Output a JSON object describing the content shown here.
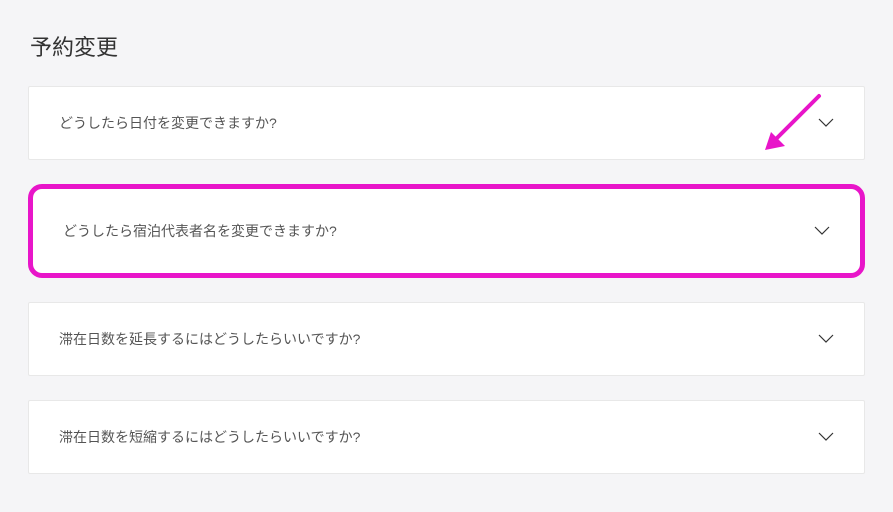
{
  "section": {
    "title": "予約変更"
  },
  "faq": {
    "items": [
      {
        "label": "どうしたら日付を変更できますか?",
        "highlighted": false
      },
      {
        "label": "どうしたら宿泊代表者名を変更できますか?",
        "highlighted": true
      },
      {
        "label": "滞在日数を延長するにはどうしたらいいですか?",
        "highlighted": false
      },
      {
        "label": "滞在日数を短縮するにはどうしたらいいですか?",
        "highlighted": false
      }
    ]
  },
  "annotation": {
    "color": "#e815c9"
  }
}
